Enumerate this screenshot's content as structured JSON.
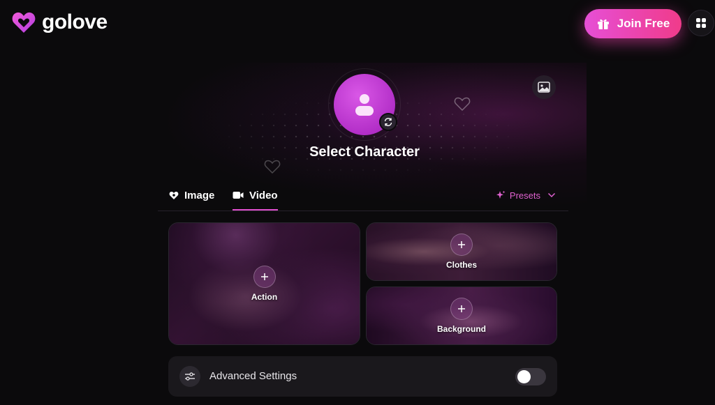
{
  "header": {
    "brand": "golove",
    "join_label": "Join Free"
  },
  "hero": {
    "title": "Select Character"
  },
  "tabs": [
    {
      "label": "Image",
      "active": false
    },
    {
      "label": "Video",
      "active": true
    }
  ],
  "presets_label": "Presets",
  "cards": {
    "action": "Action",
    "clothes": "Clothes",
    "background": "Background"
  },
  "advanced": {
    "label": "Advanced Settings",
    "enabled": false
  },
  "colors": {
    "accent": "#e04fcf",
    "join_gradient_start": "#e64fd6",
    "join_gradient_end": "#f03b8a",
    "background": "#0b0a0c"
  },
  "icons": {
    "logo": "golove-heart-logo",
    "join": "gift-icon",
    "apps": "grid-icon",
    "avatar": "user-icon",
    "refresh": "refresh-icon",
    "gallery": "image-icon",
    "image_tab": "heart-tag-icon",
    "video_tab": "video-camera-icon",
    "presets": "sparkle-icon",
    "presets_chevron": "chevron-down-icon",
    "add": "plus-icon",
    "settings": "sliders-icon"
  }
}
